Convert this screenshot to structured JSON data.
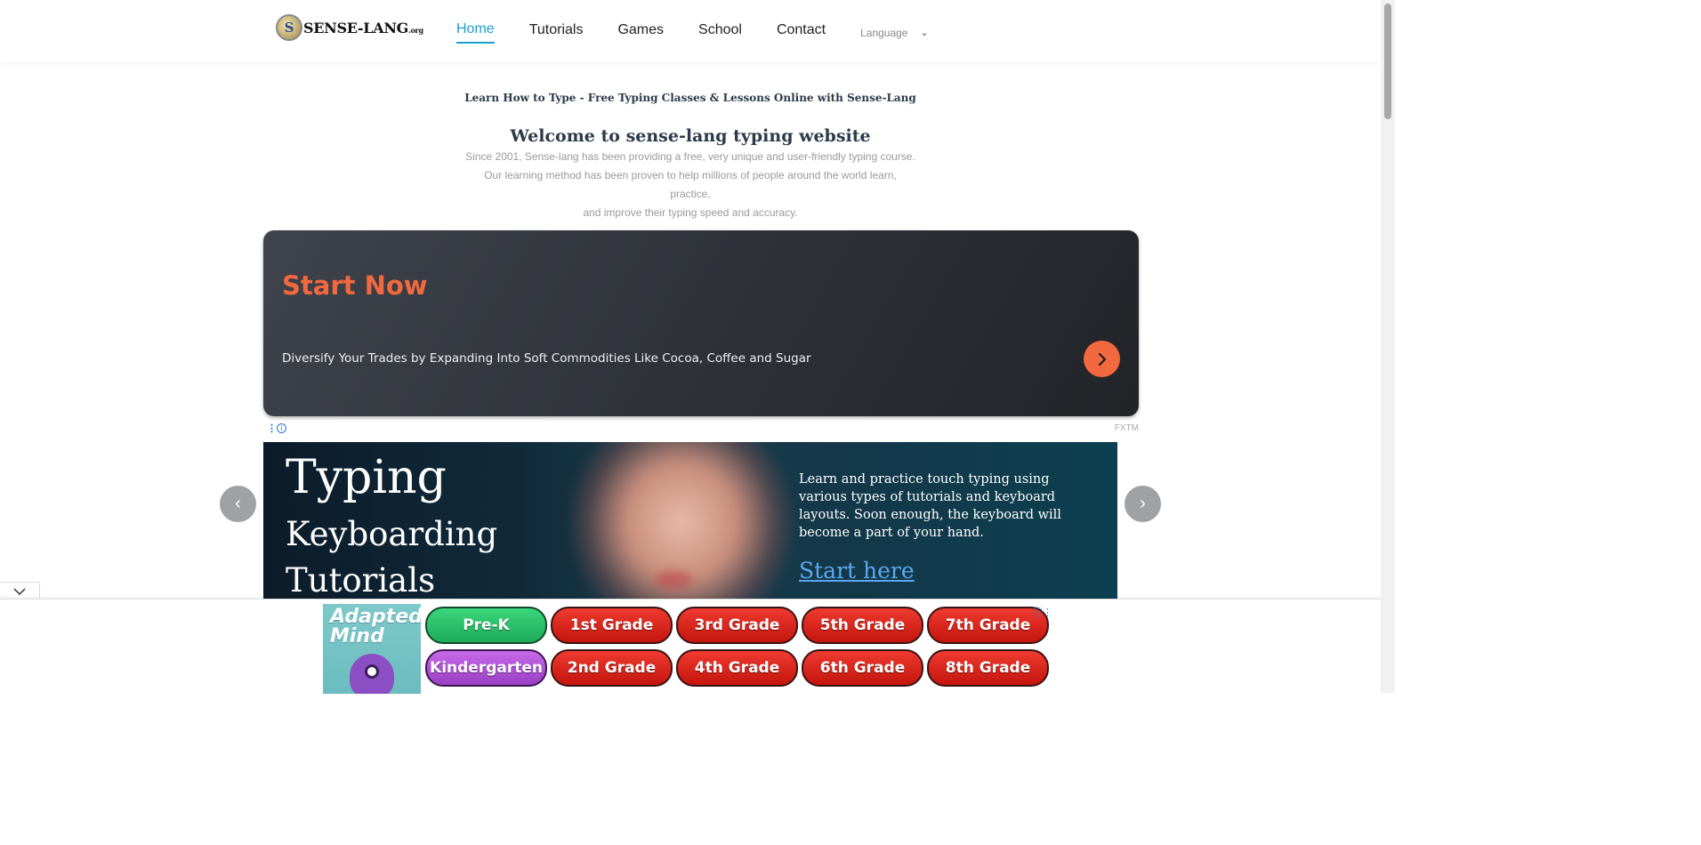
{
  "header": {
    "logo_text": "SENSE-LANG",
    "logo_suffix": ".org",
    "logo_badge": "S",
    "nav": [
      {
        "label": "Home",
        "active": true
      },
      {
        "label": "Tutorials"
      },
      {
        "label": "Games"
      },
      {
        "label": "School"
      },
      {
        "label": "Contact"
      }
    ],
    "language_label": "Language"
  },
  "intro": {
    "tagline": "Learn How to Type - Free Typing Classes & Lessons Online with Sense-Lang",
    "heading": "Welcome to sense-lang typing website",
    "line1": "Since 2001, Sense-lang has been providing a free, very unique and user-friendly typing course.",
    "line2": "Our learning method has been proven to help millions of people around the world learn, practice,",
    "line3": "and improve their typing speed and accuracy."
  },
  "ad": {
    "title": "Start Now",
    "text": "Diversify Your Trades by Expanding Into Soft Commodities Like Cocoa, Coffee and Sugar",
    "brand": "FXTM",
    "accent": "#f2683f"
  },
  "carousel": {
    "title": "Typing",
    "subtitle1": "Keyboarding",
    "subtitle2": "Tutorials",
    "description": "Learn and practice touch typing using various types of tutorials and keyboard layouts. Soon enough, the keyboard will become a part of your hand.",
    "link": "Start here",
    "prev_icon": "chevron-left-icon",
    "next_icon": "chevron-right-icon"
  },
  "bottom_ad": {
    "logo_text": "Adapted Mind",
    "grades": [
      {
        "label": "Pre-K",
        "color": "green"
      },
      {
        "label": "1st Grade",
        "color": "red"
      },
      {
        "label": "3rd Grade",
        "color": "red"
      },
      {
        "label": "5th Grade",
        "color": "red"
      },
      {
        "label": "7th Grade",
        "color": "red"
      },
      {
        "label": "Kindergarten",
        "color": "purple"
      },
      {
        "label": "2nd Grade",
        "color": "red"
      },
      {
        "label": "4th Grade",
        "color": "red"
      },
      {
        "label": "6th Grade",
        "color": "red"
      },
      {
        "label": "8th Grade",
        "color": "red"
      }
    ]
  },
  "colors": {
    "nav_active": "#1a9fd6",
    "heading": "#2d3a4a",
    "link": "#5aa9f0"
  }
}
